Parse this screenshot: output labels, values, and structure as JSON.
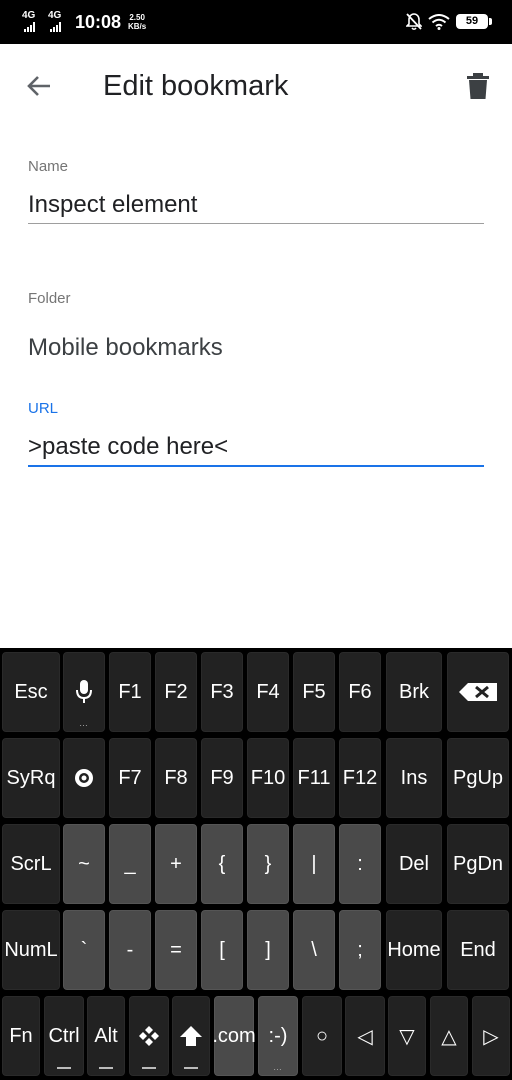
{
  "status": {
    "net1": "4G",
    "net2": "4G",
    "time": "10:08",
    "speed_value": "2.50",
    "speed_unit": "KB/s",
    "battery": "59"
  },
  "appbar": {
    "title": "Edit bookmark"
  },
  "form": {
    "name_label": "Name",
    "name_value": "Inspect element",
    "folder_label": "Folder",
    "folder_value": "Mobile bookmarks",
    "url_label": "URL",
    "url_value": ">paste code here<"
  },
  "colors": {
    "accent": "#1a73e8",
    "keyboard_bg": "#000000",
    "key_dark": "#222222",
    "key_light": "#4a4a4a"
  },
  "keyboard": {
    "row1": [
      "Esc",
      "mic-icon",
      "F1",
      "F2",
      "F3",
      "F4",
      "F5",
      "F6",
      "Brk",
      "backspace-icon"
    ],
    "row2": [
      "SyRq",
      "settings-icon",
      "F7",
      "F8",
      "F9",
      "F10",
      "F11",
      "F12",
      "Ins",
      "PgUp"
    ],
    "row3": [
      "ScrL",
      "~",
      "_",
      "+",
      "{",
      "}",
      "|",
      ":",
      "Del",
      "PgDn"
    ],
    "row4": [
      "NumL",
      "`",
      "-",
      "=",
      "[",
      "]",
      "\\",
      ";",
      "Home",
      "End"
    ],
    "row5": [
      "Fn",
      "Ctrl",
      "Alt",
      "windows-icon",
      "shift-icon",
      ".com",
      ":-)",
      "○",
      "◁",
      "▽",
      "△",
      "▷"
    ]
  }
}
